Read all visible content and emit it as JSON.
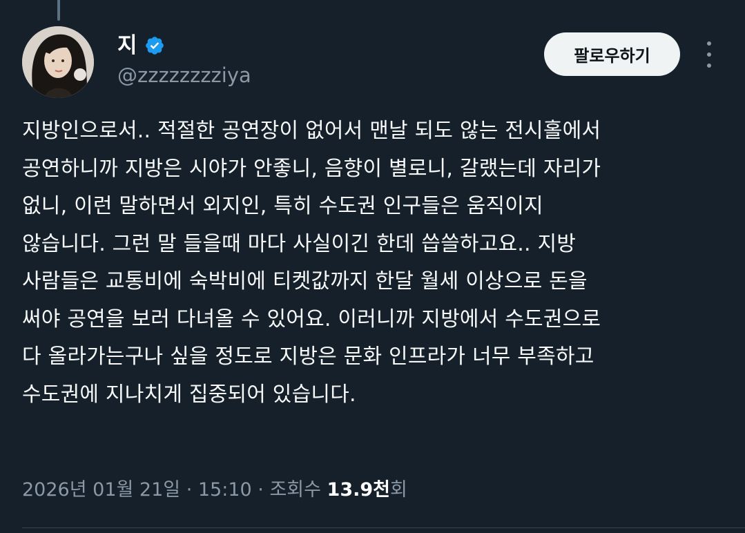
{
  "author": {
    "display_name": "지",
    "handle": "@zzzzzzzziya",
    "verified": true,
    "avatar_icon": "profile-photo"
  },
  "actions": {
    "follow_label": "팔로우하기",
    "more_icon": "more-vertical-icon"
  },
  "tweet": {
    "text": "지방인으로서.. 적절한 공연장이 없어서 맨날 되도 않는 전시홀에서\n공연하니까 지방은 시야가 안좋니, 음향이 별로니, 갈랬는데 자리가\n없니, 이런 말하면서 외지인, 특히 수도권 인구들은 움직이지\n않습니다. 그런 말 들을때 마다 사실이긴 한데 씁쓸하고요.. 지방\n사람들은 교통비에 숙박비에 티켓값까지 한달 월세 이상으로 돈을\n써야 공연을 보러 다녀올 수 있어요. 이러니까 지방에서 수도권으로\n다 올라가는구나 싶을 정도로 지방은 문화 인프라가 너무 부족하고\n수도권에 지나치게 집중되어 있습니다."
  },
  "meta": {
    "date": "2026년 01월 21일",
    "separator": " · ",
    "time": "15:10",
    "views_label": "조회수 ",
    "views_count": "13.9천",
    "views_suffix": "회"
  },
  "colors": {
    "background": "#15202b",
    "text": "#f7f9f9",
    "muted": "#8b98a5",
    "verified": "#1d9bf0",
    "button_bg": "#eff3f4"
  }
}
